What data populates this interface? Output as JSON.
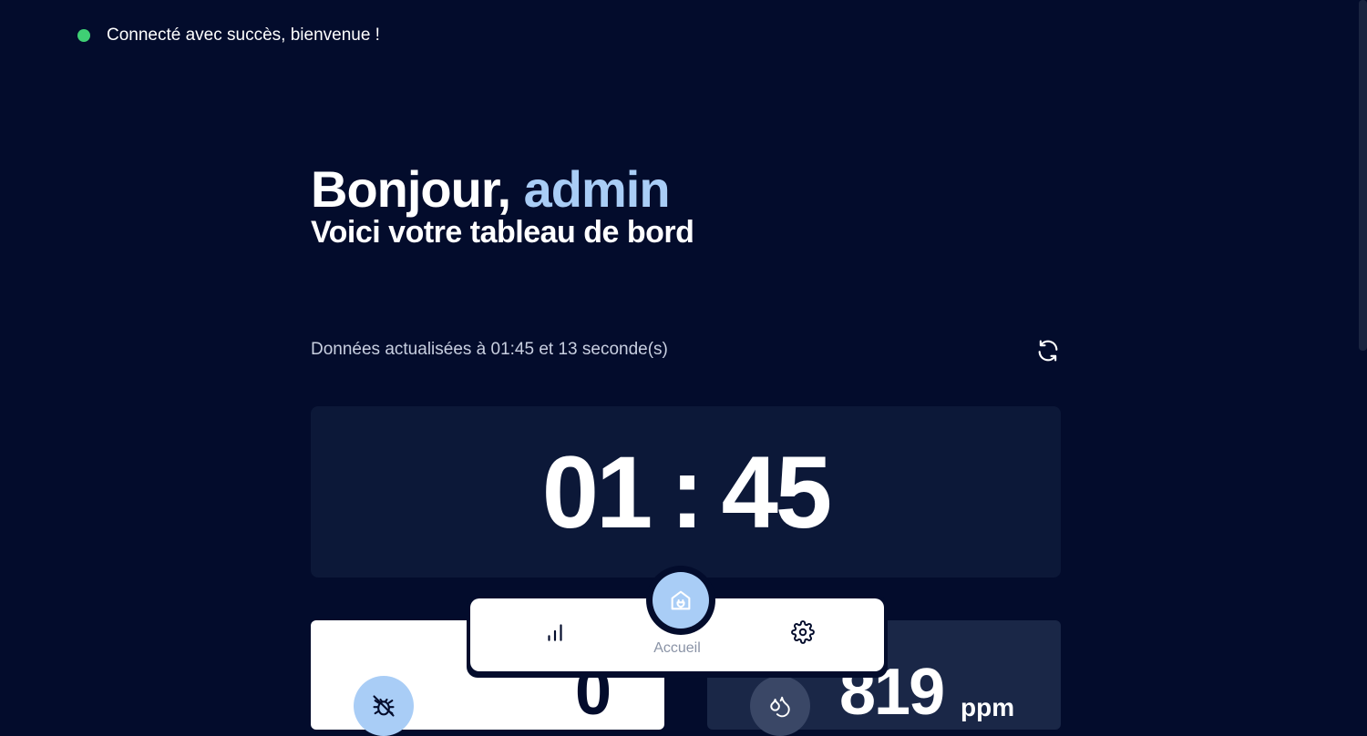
{
  "toast": {
    "message": "Connecté avec succès, bienvenue !",
    "color": "#3fcf74"
  },
  "header": {
    "greeting_prefix": "Bonjour, ",
    "username": "admin",
    "subtitle": "Voici votre tableau de bord"
  },
  "status": {
    "updated_text": "Données actualisées à 01:45 et 13 seconde(s)",
    "refresh_icon": "refresh-icon"
  },
  "clock": {
    "hours": "01",
    "separator": ":",
    "minutes": "45"
  },
  "cards": {
    "left": {
      "icon": "bug-off-icon",
      "value": "0"
    },
    "right": {
      "icon": "droplets-icon",
      "value": "819",
      "unit": "ppm"
    }
  },
  "nav": {
    "active_label": "Accueil",
    "items": [
      {
        "icon": "bar-chart-icon"
      },
      {
        "icon": "home-plug-icon"
      },
      {
        "icon": "gear-icon"
      }
    ]
  },
  "colors": {
    "background": "#030c2c",
    "accent": "#a9cdf6",
    "card": "#0c1838"
  }
}
